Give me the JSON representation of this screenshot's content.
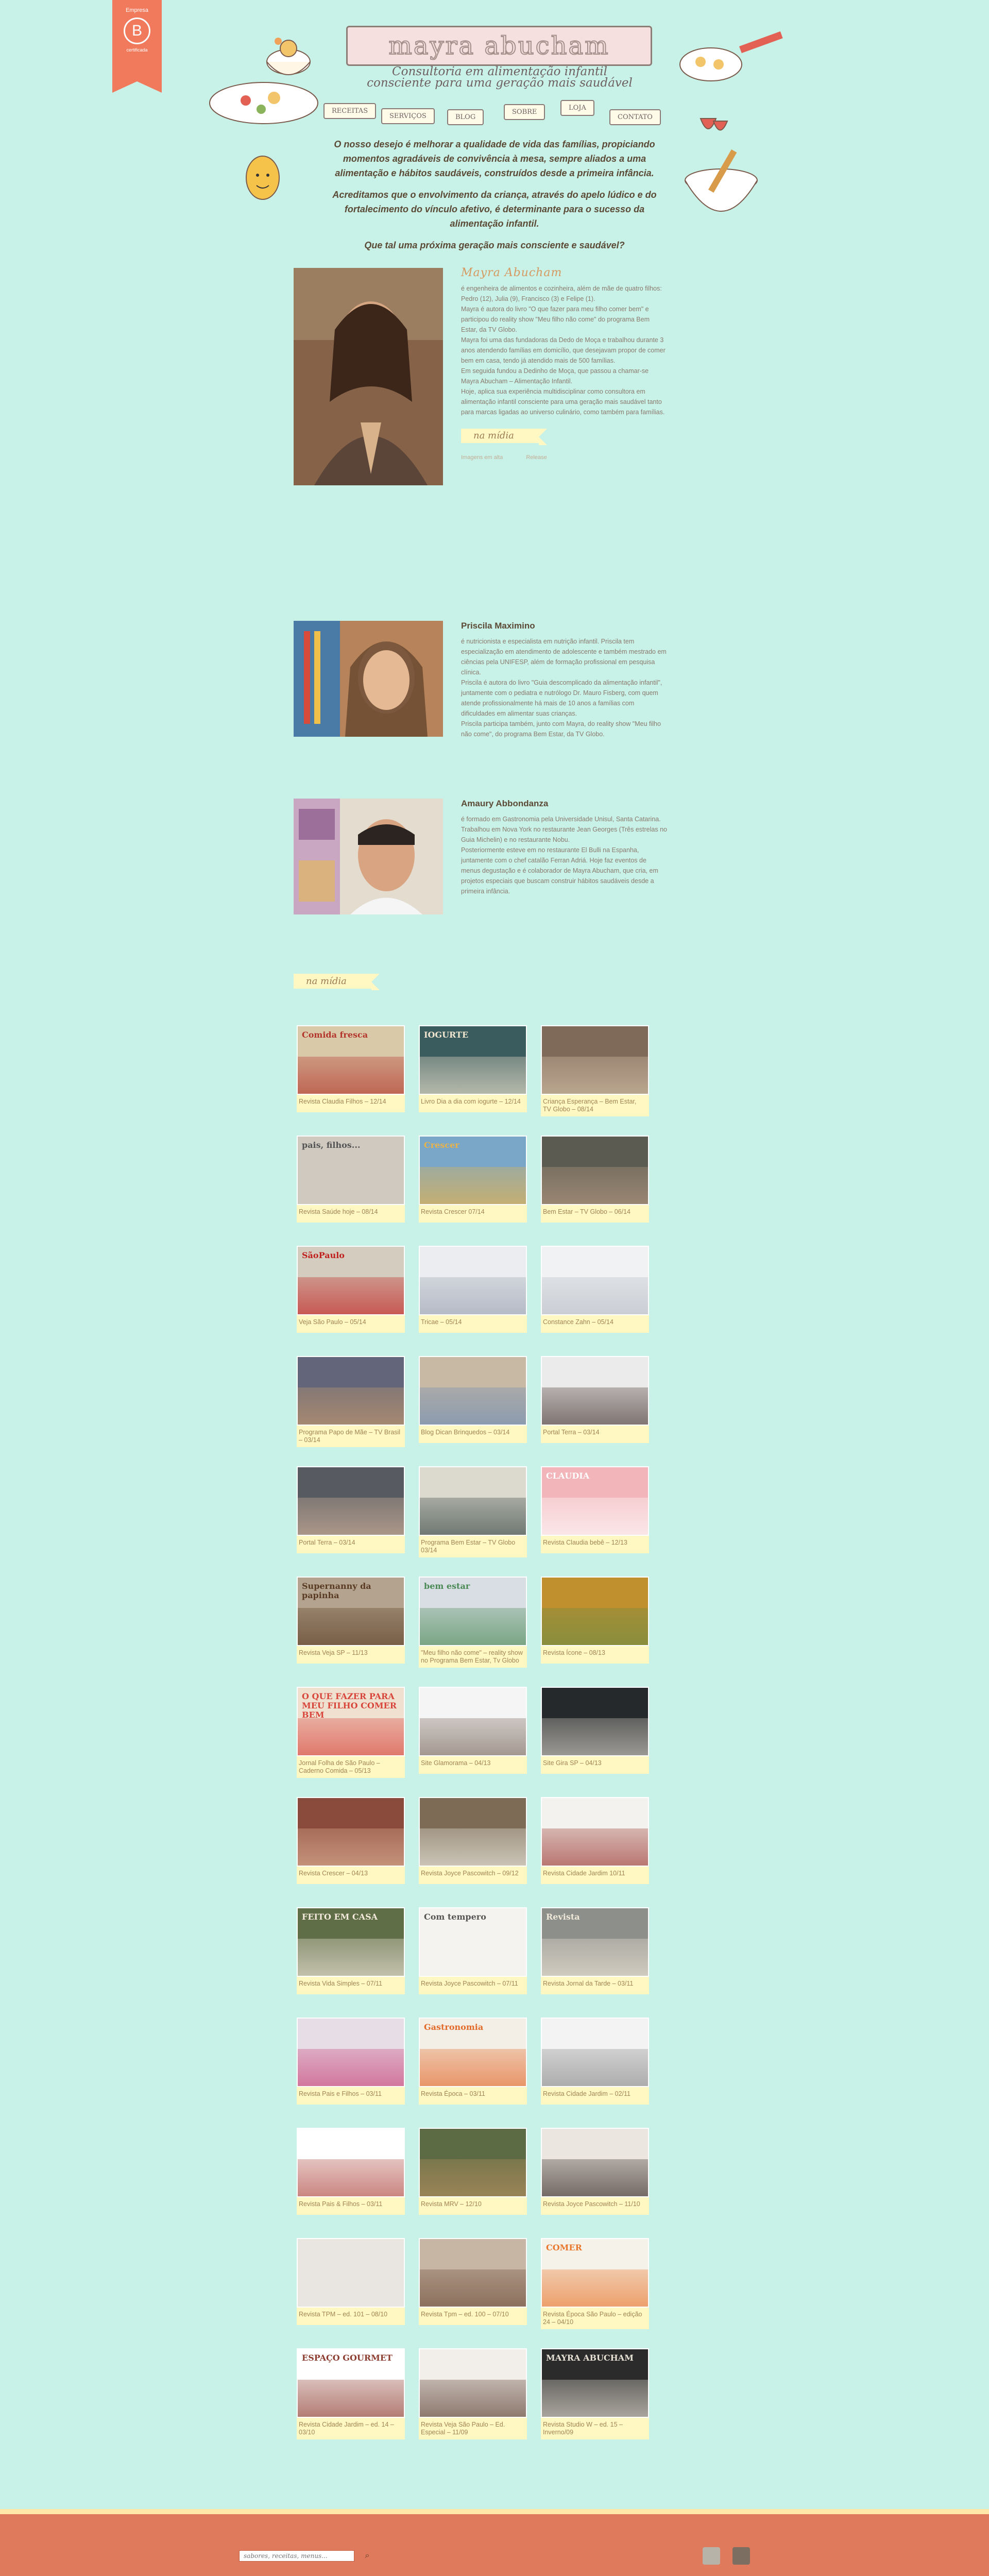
{
  "badge": {
    "top": "Empresa",
    "letter": "B",
    "bottom": "certificada"
  },
  "header": {
    "title": "mayra abucham",
    "tagline_1": "Consultoria em alimentação infantil",
    "tagline_2": "consciente para uma geração mais saudável",
    "nav": [
      "receitas",
      "serviços",
      "blog",
      "sobre",
      "loja",
      "contato"
    ]
  },
  "intro": {
    "p1": "O nosso desejo é melhorar a qualidade de vida das famílias, propiciando momentos agradáveis de convivência à mesa, sempre aliados a uma alimentação e hábitos saudáveis, construídos desde a primeira infância.",
    "p2": "Acreditamos que o envolvimento da criança, através do apelo lúdico e do fortalecimento do vínculo afetivo, é determinante para o sucesso da alimentação infantil.",
    "p3": "Que tal uma próxima geração mais consciente e saudável?"
  },
  "profiles": [
    {
      "name": "Mayra Abucham",
      "text": "é engenheira de alimentos e cozinheira, além de mãe de quatro filhos: Pedro (12), Julia (9), Francisco (3) e Felipe (1).\nMayra é autora do livro \"O que fazer para meu filho comer bem\" e participou do reality show \"Meu filho não come\" do programa Bem Estar, da TV Globo.\nMayra foi uma das fundadoras da Dedo de Moça e trabalhou durante 3 anos atendendo famílias em domicílio, que desejavam propor de comer bem em casa, tendo já atendido mais de 500 famílias.\nEm seguida fundou a Dedinho de Moça, que passou a chamar-se Mayra Abucham – Alimentação Infantil.\nHoje, aplica sua experiência multidisciplinar como consultora em alimentação infantil consciente para uma geração mais saudável tanto para marcas ligadas ao universo culinário, como também para famílias.",
      "tag": "na mídia",
      "link1": "Imagens em alta",
      "link2": "Release"
    },
    {
      "name": "Priscila Maximino",
      "text": "é nutricionista e especialista em nutrição infantil. Priscila tem especialização em atendimento de adolescente e também mestrado em ciências pela UNIFESP, além de formação profissional em pesquisa clínica.\nPriscila é autora do livro \"Guia descomplicado da alimentação infantil\", juntamente com o pediatra e nutrólogo Dr. Mauro Fisberg, com quem atende profissionalmente há mais de 10 anos a famílias com dificuldades em alimentar suas crianças.\nPriscila participa também, junto com Mayra, do reality show \"Meu filho não come\", do programa Bem Estar, da TV Globo."
    },
    {
      "name": "Amaury Abbondanza",
      "text": "é formado em Gastronomia pela Universidade Unisul, Santa Catarina.\nTrabalhou em Nova York no restaurante Jean Georges (Três estrelas no Guia Michelin) e no restaurante Nobu.\nPosteriormente esteve em no restaurante El Bulli na Espanha, juntamente com o chef catalão Ferran Adriá. Hoje faz eventos de menus degustação e é colaborador de Mayra Abucham, que cria, em projetos especiais que buscam construir hábitos saudáveis desde a primeira infância."
    }
  ],
  "midia_title": "na mídia",
  "media": [
    {
      "caption": "Revista Claudia Filhos – 12/14",
      "color": "#d9c9a8",
      "accent": "#b3352c",
      "label": "Comida fresca"
    },
    {
      "caption": "Livro Dia a dia com iogurte – 12/14",
      "color": "#3b5c5e",
      "accent": "#f1e6d0",
      "label": "IOGURTE"
    },
    {
      "caption": "Criança Esperança – Bem Estar, TV Globo – 08/14",
      "color": "#7f6a5a",
      "accent": "#d7c4a9",
      "label": ""
    },
    {
      "caption": "Revista Saúde hoje – 08/14",
      "color": "#cfc9c0",
      "accent": "#555",
      "label": "pais, filhos..."
    },
    {
      "caption": "Revista Crescer 07/14",
      "color": "#7aa7c7",
      "accent": "#e8b34a",
      "label": "Crescer"
    },
    {
      "caption": "Bem Estar – TV Globo – 06/14",
      "color": "#5c5b52",
      "accent": "#b79c82",
      "label": ""
    },
    {
      "caption": "Veja São Paulo – 05/14",
      "color": "#d4cdbf",
      "accent": "#c0201e",
      "label": "SãoPaulo"
    },
    {
      "caption": "Tricae – 05/14",
      "color": "#ecedf0",
      "accent": "#9aa3b2",
      "label": ""
    },
    {
      "caption": "Constance Zahn – 05/14",
      "color": "#f1f2f4",
      "accent": "#b7bcc4",
      "label": ""
    },
    {
      "caption": "Programa Papo de Mãe – TV Brasil – 03/14",
      "color": "#63667a",
      "accent": "#c69a6c",
      "label": ""
    },
    {
      "caption": "Blog Dican Brinquedos – 03/14",
      "color": "#c8b9a4",
      "accent": "#6e8cb4",
      "label": ""
    },
    {
      "caption": "Portal Terra – 03/14",
      "color": "#ecebec",
      "accent": "#4a3a36",
      "label": ""
    },
    {
      "caption": "Portal Terra – 03/14",
      "color": "#575b61",
      "accent": "#d3b49c",
      "label": ""
    },
    {
      "caption": "Programa Bem Estar – TV Globo 03/14",
      "color": "#dcd9cf",
      "accent": "#3a4a46",
      "label": ""
    },
    {
      "caption": "Revista Claudia bebê – 12/13",
      "color": "#f2b6ba",
      "accent": "#ffffff",
      "label": "CLAUDIA"
    },
    {
      "caption": "Revista Veja SP – 11/13",
      "color": "#b4a48f",
      "accent": "#5a3b23",
      "label": "Supernanny da papinha"
    },
    {
      "caption": "\"Meu filho não come\" – reality show no Programa Bem Estar, Tv Globo",
      "color": "#d8dee4",
      "accent": "#4b8a55",
      "label": "bem estar"
    },
    {
      "caption": "Revista Ícone – 08/13",
      "color": "#c0902e",
      "accent": "#6d8c45",
      "label": ""
    },
    {
      "caption": "Jornal Folha de São Paulo – Caderno Comida – 05/13",
      "color": "#f0e0d0",
      "accent": "#d8453b",
      "label": "O QUE FAZER PARA MEU FILHO COMER BEM"
    },
    {
      "caption": "Site Glamorama – 04/13",
      "color": "#f5f5f5",
      "accent": "#7b6a5e",
      "label": ""
    },
    {
      "caption": "Site Gira SP – 04/13",
      "color": "#26292b",
      "accent": "#d5d0c8",
      "label": ""
    },
    {
      "caption": "Revista Crescer – 04/13",
      "color": "#8a4b3c",
      "accent": "#e2b497",
      "label": ""
    },
    {
      "caption": "Revista Joyce Pascowitch – 09/12",
      "color": "#7d6b55",
      "accent": "#f0efe6",
      "label": ""
    },
    {
      "caption": "Revista Cidade Jardim 10/11",
      "color": "#f3f2ef",
      "accent": "#9d3a33",
      "label": ""
    },
    {
      "caption": "Revista Vida Simples – 07/11",
      "color": "#606e48",
      "accent": "#f3eadc",
      "label": "FEITO EM CASA"
    },
    {
      "caption": "Revista Joyce Pascowitch – 07/11",
      "color": "#f4f3ef",
      "accent": "#555",
      "label": "Com tempero"
    },
    {
      "caption": "Revista Jornal da Tarde – 03/11",
      "color": "#8d8f8b",
      "accent": "#f0e8d8",
      "label": "Revista"
    },
    {
      "caption": "Revista Pais e Filhos – 03/11",
      "color": "#e7dde7",
      "accent": "#c8457a",
      "label": ""
    },
    {
      "caption": "Revista Época – 03/11",
      "color": "#f4efe6",
      "accent": "#e26a2b",
      "label": "Gastronomia"
    },
    {
      "caption": "Revista Cidade Jardim – 02/11",
      "color": "#f3f3f3",
      "accent": "#8a8a8a",
      "label": ""
    },
    {
      "caption": "Revista Pais & Filhos – 03/11",
      "color": "#ffffff",
      "accent": "#b04a42",
      "label": ""
    },
    {
      "caption": "Revista MRV – 12/10",
      "color": "#5d6b45",
      "accent": "#b7905e",
      "label": ""
    },
    {
      "caption": "Revista Joyce Pascowitch – 11/10",
      "color": "#ebe6df",
      "accent": "#3b2e2a",
      "label": ""
    },
    {
      "caption": "Revista TPM – ed. 101 – 08/10",
      "color": "#e9e6e2",
      "accent": "#555",
      "label": ""
    },
    {
      "caption": "Revista Tpm – ed. 100 – 07/10",
      "color": "#c8b6a4",
      "accent": "#6d4d3a",
      "label": ""
    },
    {
      "caption": "Revista Época São Paulo – edição 24 – 04/10",
      "color": "#f5f2ea",
      "accent": "#e9772d",
      "label": "COMER"
    },
    {
      "caption": "Revista Cidade Jardim – ed. 14 – 03/10",
      "color": "#ffffff",
      "accent": "#8e3c2f",
      "label": "ESPAÇO GOURMET"
    },
    {
      "caption": "Revista Veja São Paulo – Ed. Especial – 11/09",
      "color": "#f2eeea",
      "accent": "#5c4032",
      "label": ""
    },
    {
      "caption": "Revista Studio W – ed. 15 – Inverno/09",
      "color": "#2b2b2b",
      "accent": "#e8e2d6",
      "label": "MAYRA ABUCHAM"
    }
  ],
  "footer": {
    "search_placeholder": "sabores, receitas, menus...",
    "search_icon": "search-icon",
    "social": [
      "pinterest-icon",
      "instagram-icon"
    ]
  }
}
